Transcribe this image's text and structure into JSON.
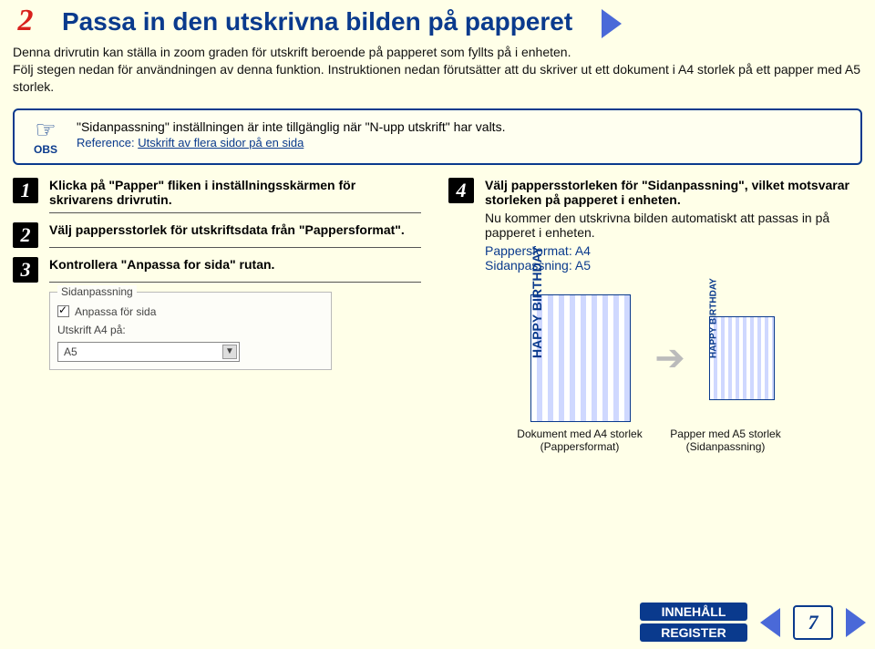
{
  "header": {
    "step_number": "2",
    "title": "Passa in den utskrivna bilden på papperet"
  },
  "intro": {
    "p1": "Denna drivrutin kan ställa in zoom graden för utskrift beroende på papperet som fyllts på i enheten.",
    "p2": "Följ stegen nedan för användningen av denna funktion. Instruktionen nedan förutsätter att du skriver ut ett dokument i A4 storlek på ett papper med A5 storlek."
  },
  "obs": {
    "label": "OBS",
    "text": "\"Sidanpassning\" inställningen är inte tillgänglig när \"N-upp utskrift\" har valts.",
    "ref_label": "Reference:",
    "ref_link": "Utskrift av flera sidor på en sida"
  },
  "left_steps": [
    {
      "num": "1",
      "text": "Klicka på \"Papper\" fliken i inställningsskärmen för skrivarens drivrutin."
    },
    {
      "num": "2",
      "text": "Välj pappersstorlek för utskriftsdata från \"Pappersformat\"."
    },
    {
      "num": "3",
      "text": "Kontrollera \"Anpassa for sida\" rutan."
    }
  ],
  "mock": {
    "legend": "Sidanpassning",
    "check_label": "Anpassa för sida",
    "print_on": "Utskrift A4 på:",
    "select_value": "A5"
  },
  "right_step": {
    "num": "4",
    "text": "Välj pappersstorleken för \"Sidanpassning\", vilket motsvarar storleken på papperet i enheten.",
    "sub": "Nu kommer den utskrivna bilden automatiskt att passas in på papperet i enheten.",
    "meta1": "Pappersformat: A4",
    "meta2": "Sidanpassning: A5"
  },
  "diagram": {
    "paper_text": "HAPPY BIRTHDAY",
    "caption_left": "Dokument med A4 storlek (Pappersformat)",
    "caption_right": "Papper med A5 storlek (Sidanpassning)"
  },
  "footer": {
    "innehall": "INNEHÅLL",
    "register": "REGISTER",
    "page": "7"
  }
}
